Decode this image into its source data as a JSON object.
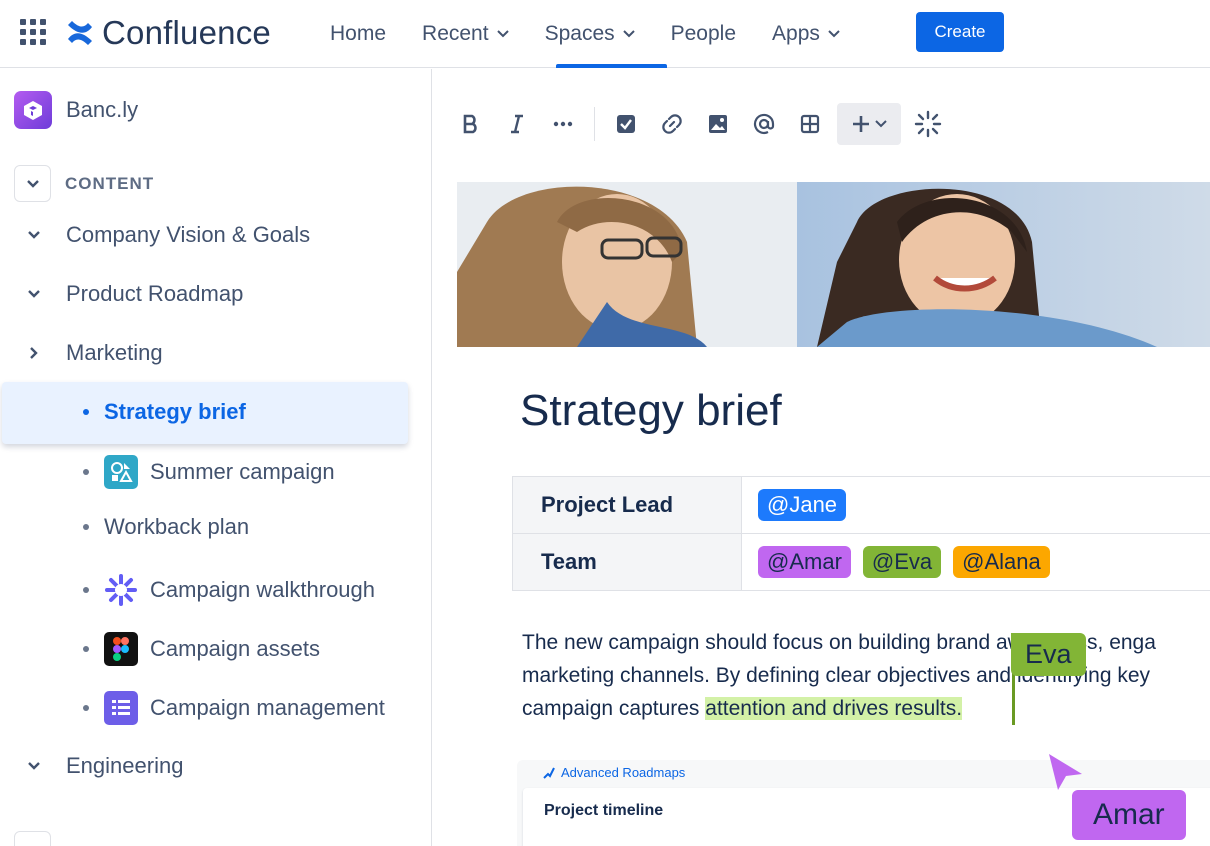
{
  "topbar": {
    "logo": "Confluence",
    "nav": [
      {
        "label": "Home"
      },
      {
        "label": "Recent"
      },
      {
        "label": "Spaces"
      },
      {
        "label": "People"
      },
      {
        "label": "Apps"
      }
    ],
    "create_label": "Create"
  },
  "sidebar": {
    "space_name": "Banc.ly",
    "section_label": "CONTENT",
    "items": [
      {
        "label": "Company Vision & Goals"
      },
      {
        "label": "Product Roadmap"
      },
      {
        "label": "Marketing"
      },
      {
        "label": "Engineering"
      }
    ],
    "children": [
      {
        "label": "Strategy brief"
      },
      {
        "label": "Summer campaign"
      },
      {
        "label": "Workback plan"
      },
      {
        "label": "Campaign walkthrough"
      },
      {
        "label": "Campaign assets"
      },
      {
        "label": "Campaign management"
      }
    ]
  },
  "page": {
    "title": "Strategy brief",
    "table": {
      "lead_label": "Project Lead",
      "lead_value": "@Jane",
      "team_label": "Team",
      "team": [
        "@Amar",
        "@Eva",
        "@Alana"
      ]
    },
    "body": {
      "line1": "The new campaign should focus on building brand awareness, enga",
      "line2": "marketing channels. By defining clear objectives and identifying key",
      "line3_pre": "campaign captures ",
      "line3_hl": "attention and drives results."
    },
    "cursors": {
      "eva": "Eva",
      "amar": "Amar"
    },
    "roadmap": {
      "label": "Advanced Roadmaps",
      "title": "Project timeline"
    }
  },
  "colors": {
    "accent": "#0c66e4",
    "jane": "#1d7afc",
    "amar": "#c067f0",
    "eva": "#82b536",
    "alana": "#fca700",
    "highlight": "#d3f1a7"
  }
}
